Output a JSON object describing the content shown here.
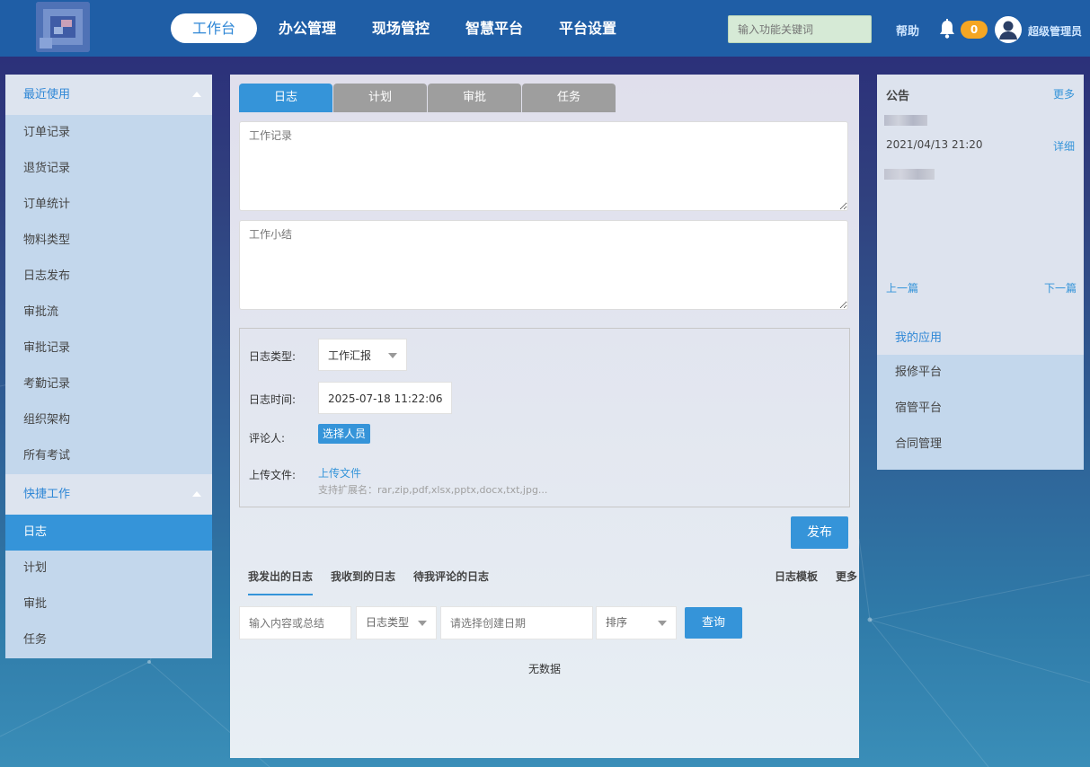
{
  "header": {
    "nav": [
      {
        "label": "工作台",
        "active": true
      },
      {
        "label": "办公管理",
        "active": false
      },
      {
        "label": "现场管控",
        "active": false
      },
      {
        "label": "智慧平台",
        "active": false
      },
      {
        "label": "平台设置",
        "active": false
      }
    ],
    "search_placeholder": "输入功能关键词",
    "help_label": "帮助",
    "notification_count": "0",
    "username": "超级管理员"
  },
  "sidebar": {
    "recent_group": "最近使用",
    "recent_items": [
      "订单记录",
      "退货记录",
      "订单统计",
      "物料类型",
      "日志发布",
      "审批流",
      "审批记录",
      "考勤记录",
      "组织架构",
      "所有考试"
    ],
    "quick_group": "快捷工作",
    "quick_items": [
      {
        "label": "日志",
        "active": true
      },
      {
        "label": "计划",
        "active": false
      },
      {
        "label": "审批",
        "active": false
      },
      {
        "label": "任务",
        "active": false
      }
    ]
  },
  "main": {
    "tabs": [
      {
        "label": "日志",
        "active": true
      },
      {
        "label": "计划",
        "active": false
      },
      {
        "label": "审批",
        "active": false
      },
      {
        "label": "任务",
        "active": false
      }
    ],
    "work_record_placeholder": "工作记录",
    "work_summary_placeholder": "工作小结",
    "form": {
      "log_type_label": "日志类型:",
      "log_type_value": "工作汇报",
      "log_time_label": "日志时间:",
      "log_time_value": "2025-07-18 11:22:06",
      "reviewer_label": "评论人:",
      "reviewer_button": "选择人员",
      "upload_label": "上传文件:",
      "upload_link": "上传文件",
      "upload_hint": "支持扩展名：rar,zip,pdf,xlsx,pptx,docx,txt,jpg..."
    },
    "publish_button": "发布",
    "sub_tabs": [
      {
        "label": "我发出的日志",
        "active": true
      },
      {
        "label": "我收到的日志",
        "active": false
      },
      {
        "label": "待我评论的日志",
        "active": false
      }
    ],
    "right_links": [
      "日志模板",
      "更多"
    ],
    "filters": {
      "content_placeholder": "输入内容或总结",
      "log_type": "日志类型",
      "date_placeholder": "请选择创建日期",
      "sort": "排序"
    },
    "query_button": "查询",
    "no_data": "无数据"
  },
  "notice": {
    "title": "公告",
    "more": "更多",
    "date": "2021/04/13 21:20",
    "detail": "详细",
    "prev": "上一篇",
    "next": "下一篇"
  },
  "apps": {
    "title": "我的应用",
    "items": [
      "报修平台",
      "宿管平台",
      "合同管理"
    ]
  },
  "colors": {
    "accent": "#3594d9",
    "header_bg": "#1f5ea6",
    "badge": "#f5a623"
  }
}
